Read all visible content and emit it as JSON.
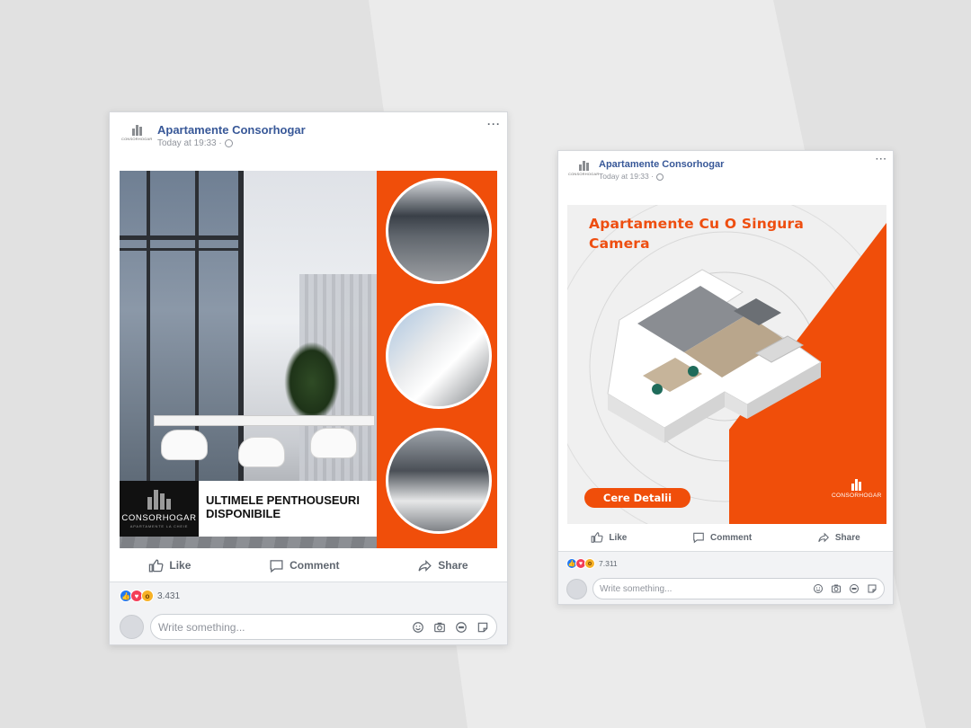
{
  "colors": {
    "accent": "#f04e0a",
    "facebook_blue": "#385898",
    "like_blue": "#2078f4",
    "love_red": "#f33e58",
    "wow_yellow": "#f7b125"
  },
  "posts": [
    {
      "page_name": "Apartamente Consorhogar",
      "logo_text": "CONSORHOGAR",
      "timestamp": "Today at 19:33 ·",
      "more_label": "···",
      "creative": {
        "brand_name": "CONSORHOGAR",
        "brand_tagline": "APARTAMENTE LA CHEIE",
        "headline_line1": "ULTIMELE PENTHOUSEURI",
        "headline_line2": "DISPONIBILE"
      },
      "actions": {
        "like": "Like",
        "comment": "Comment",
        "share": "Share"
      },
      "reaction_count": "3.431",
      "comment_placeholder": "Write something..."
    },
    {
      "page_name": "Apartamente Consorhogar",
      "logo_text": "CONSORHOGAR",
      "timestamp": "Today at 19:33 ·",
      "more_label": "···",
      "creative": {
        "title_line1": "Apartamente Cu O Singura",
        "title_line2": "Camera",
        "cta_label": "Cere Detalii",
        "brand_name": "CONSORHOGAR"
      },
      "actions": {
        "like": "Like",
        "comment": "Comment",
        "share": "Share"
      },
      "reaction_count": "7.311",
      "comment_placeholder": "Write something..."
    }
  ],
  "icons": {
    "more": "more-icon",
    "globe": "globe-icon",
    "like": "thumbs-up-icon",
    "comment": "speech-bubble-icon",
    "share": "share-arrow-icon",
    "emoji": "emoji-icon",
    "camera": "camera-icon",
    "gif": "gif-icon",
    "sticker": "sticker-icon"
  }
}
